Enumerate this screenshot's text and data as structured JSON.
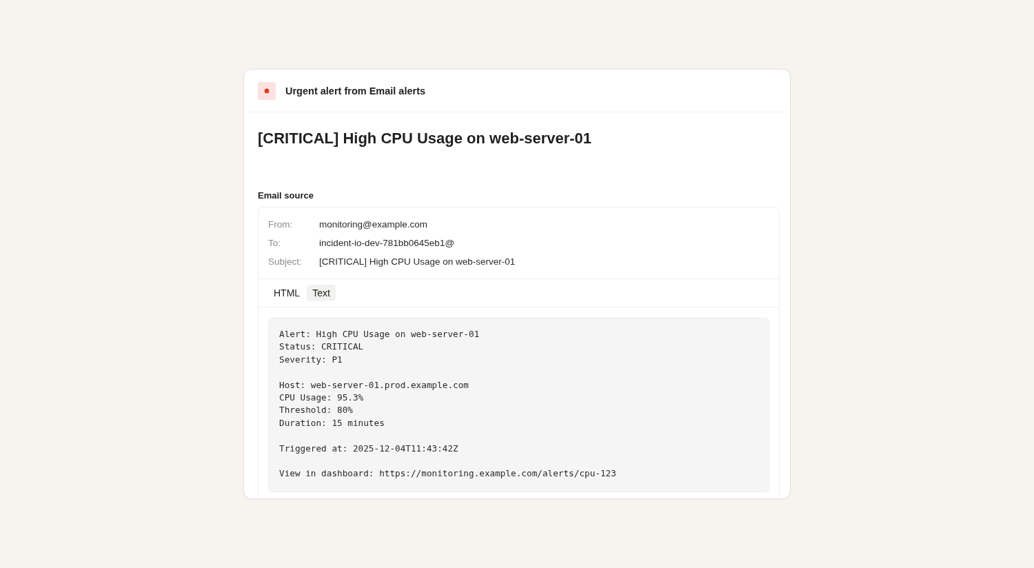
{
  "header": {
    "title": "Urgent alert from Email alerts"
  },
  "alert_title": "[CRITICAL] High CPU Usage on web-server-01",
  "email_source": {
    "heading": "Email source",
    "fields": [
      {
        "label": "From:",
        "value": "monitoring@example.com"
      },
      {
        "label": "To:",
        "value": "incident-io-dev-781bb0645eb1@"
      },
      {
        "label": "Subject:",
        "value": "[CRITICAL] High CPU Usage on web-server-01"
      }
    ],
    "tabs": [
      {
        "label": "HTML",
        "selected": false
      },
      {
        "label": "Text",
        "selected": true
      }
    ],
    "body": "Alert: High CPU Usage on web-server-01\nStatus: CRITICAL\nSeverity: P1\n\nHost: web-server-01.prod.example.com\nCPU Usage: 95.3%\nThreshold: 80%\nDuration: 15 minutes\n\nTriggered at: 2025-12-04T11:43:42Z\n\nView in dashboard: https://monitoring.example.com/alerts/cpu-123"
  }
}
